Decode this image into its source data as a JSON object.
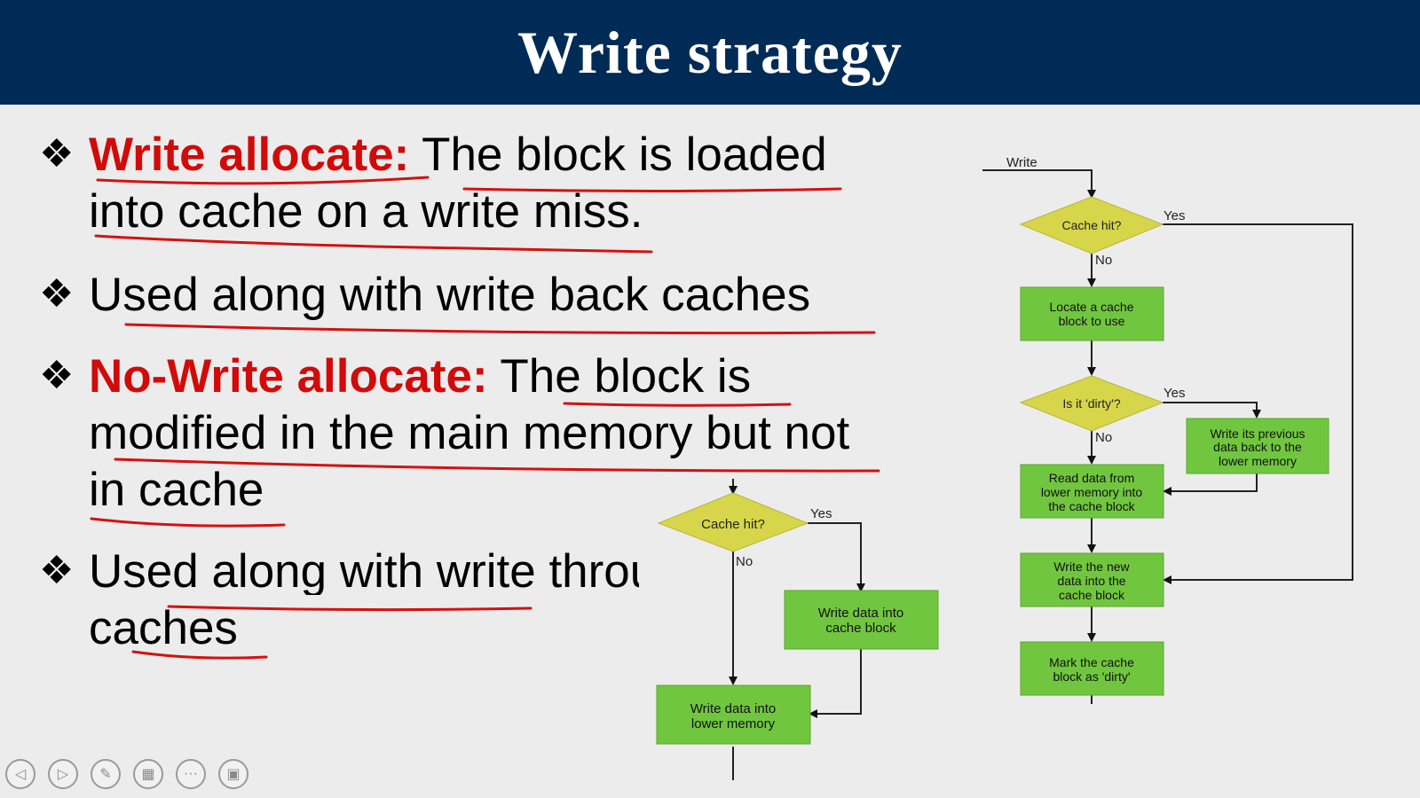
{
  "slide": {
    "title": "Write strategy"
  },
  "bullets": [
    {
      "lead": "Write allocate:",
      "rest": " The block is loaded",
      "line2": "into cache on a write miss."
    },
    {
      "text": "Used along with write back caches"
    },
    {
      "lead": "No-Write allocate:",
      "rest": " The block is",
      "line2": "modified in the main memory but not",
      "line3": "in cache"
    },
    {
      "text": "Used along with write through",
      "line2": "caches"
    }
  ],
  "flowchart_left": {
    "decision": "Cache hit?",
    "yes": "Yes",
    "no": "No",
    "box_cache_l1": "Write data into",
    "box_cache_l2": "cache block",
    "box_mem_l1": "Write data into",
    "box_mem_l2": "lower memory"
  },
  "flowchart_right": {
    "start": "Write",
    "decision_hit": "Cache hit?",
    "yes1": "Yes",
    "no1": "No",
    "box_locate_l1": "Locate a cache",
    "box_locate_l2": "block to use",
    "decision_dirty": "Is it 'dirty'?",
    "yes2": "Yes",
    "no2": "No",
    "box_writeback_l1": "Write its previous",
    "box_writeback_l2": "data back to the",
    "box_writeback_l3": "lower memory",
    "box_read_l1": "Read data from",
    "box_read_l2": "lower memory into",
    "box_read_l3": "the cache block",
    "box_new_l1": "Write the new",
    "box_new_l2": "data into the",
    "box_new_l3": "cache block",
    "box_mark_l1": "Mark the cache",
    "box_mark_l2": "block as 'dirty'"
  },
  "toolbar": {
    "buttons": [
      "previous-icon",
      "next-icon",
      "pen-icon",
      "slides-icon",
      "more-icon",
      "presenter-icon"
    ]
  },
  "colors": {
    "title_bar": "#002b57",
    "accent_red": "#d10a0a",
    "decision_fill": "#d7d64a",
    "process_fill": "#71c63f"
  }
}
